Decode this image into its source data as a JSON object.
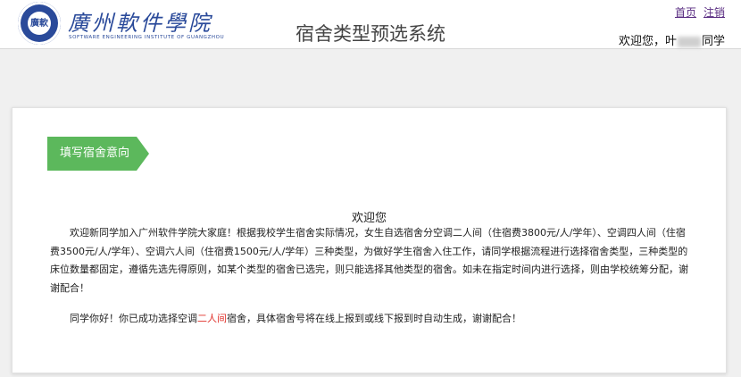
{
  "header": {
    "logo": {
      "seal_text": "廣軟",
      "name": "廣州軟件學院",
      "sub": "SOFTWARE ENGINEERING INSTITUTE OF GUANGZHOU"
    },
    "title": "宿舍类型预选系统",
    "links": {
      "home": "首页",
      "logout": "注销"
    },
    "welcome_prefix": "欢迎您，叶",
    "welcome_suffix": "同学"
  },
  "card": {
    "step_label": "填写宿舍意向",
    "heading": "欢迎您",
    "intro": "欢迎新同学加入广州软件学院大家庭！根据我校学生宿舍实际情况，女生自选宿舍分空调二人间（住宿费3800元/人/学年）、空调四人间（住宿费3500元/人/学年）、空调六人间（住宿费1500元/人/学年）三种类型，为做好学生宿舍入住工作，请同学根据流程进行选择宿舍类型，三种类型的床位数量都固定，遵循先选先得原则，如某个类型的宿舍已选完，则只能选择其他类型的宿舍。如未在指定时间内进行选择，则由学校统筹分配，谢谢配合！",
    "result_before": "同学你好！你已成功选择空调",
    "result_highlight": "二人间",
    "result_after": "宿舍，具体宿舍号将在线上报到或线下报到时自动生成，谢谢配合！"
  },
  "colors": {
    "brand_blue": "#2a4a9a",
    "step_green": "#5cb85c",
    "highlight_red": "#e0302a",
    "link_purple": "#5a2d82"
  }
}
